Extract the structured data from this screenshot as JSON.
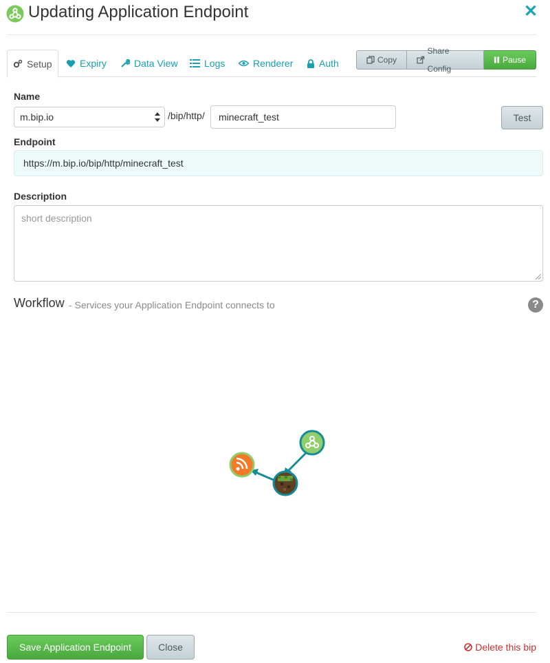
{
  "header": {
    "title": "Updating Application Endpoint",
    "icon": "webhook-icon"
  },
  "tabs": [
    {
      "label": "Setup",
      "icon": "gears-icon",
      "active": true
    },
    {
      "label": "Expiry",
      "icon": "heart-icon"
    },
    {
      "label": "Data View",
      "icon": "wrench-icon"
    },
    {
      "label": "Logs",
      "icon": "list-icon"
    },
    {
      "label": "Renderer",
      "icon": "eye-icon"
    },
    {
      "label": "Auth",
      "icon": "lock-icon"
    }
  ],
  "toolbar": {
    "copy_label": "Copy",
    "share_label": "Share Config",
    "pause_label": "Pause"
  },
  "form": {
    "name_label": "Name",
    "domain_value": "m.bip.io",
    "path_prefix": "/bip/http/",
    "name_value": "minecraft_test",
    "test_label": "Test",
    "endpoint_label": "Endpoint",
    "endpoint_value": "https://m.bip.io/bip/http/minecraft_test",
    "description_label": "Description",
    "description_placeholder": "short description"
  },
  "workflow": {
    "title": "Workflow",
    "subtitle": "- Services your Application Endpoint connects to",
    "nodes": [
      "webhook",
      "minecraft",
      "rss"
    ]
  },
  "footer": {
    "save_label": "Save Application Endpoint",
    "close_label": "Close",
    "delete_label": "Delete this bip"
  },
  "colors": {
    "accent": "#179fb2",
    "success": "#4aa93d",
    "danger": "#c9302c"
  }
}
